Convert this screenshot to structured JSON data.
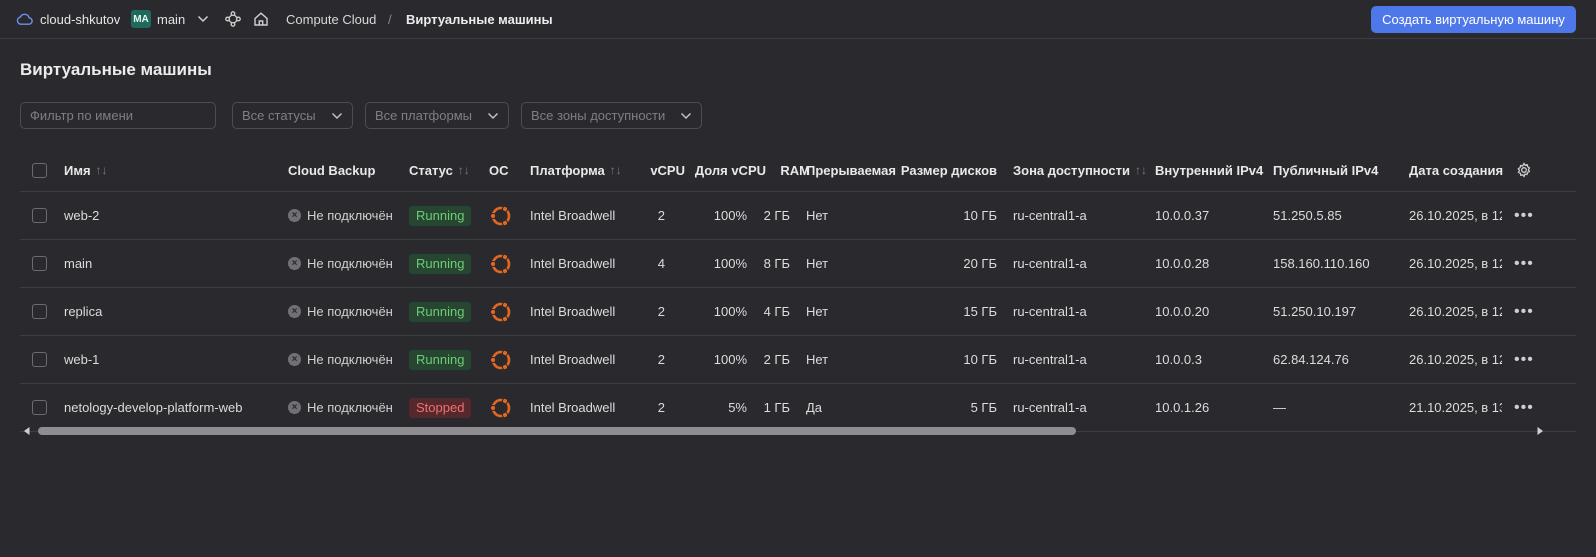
{
  "header": {
    "cloud_name": "cloud-shkutov",
    "folder_badge": "MA",
    "folder_name": "main",
    "service": "Compute Cloud",
    "separator": "/",
    "current_page": "Виртуальные машины",
    "create_button": "Создать виртуальную машину",
    "accent_color": "#4e78ea"
  },
  "page": {
    "title": "Виртуальные машины"
  },
  "filters": {
    "name_placeholder": "Фильтр по имени",
    "status": "Все статусы",
    "platform": "Все платформы",
    "zone": "Все зоны доступности"
  },
  "table": {
    "columns": {
      "name": "Имя",
      "backup": "Cloud Backup",
      "status": "Статус",
      "os": "ОС",
      "platform": "Платформа",
      "vcpu": "vCPU",
      "vcpu_share": "Доля vCPU",
      "ram": "RAM",
      "preemptible": "Прерываемая",
      "disk_size": "Размер дисков",
      "zone": "Зона доступности",
      "internal_ip": "Внутренний IPv4",
      "public_ip": "Публичный IPv4",
      "created": "Дата создания"
    },
    "sort_icon": "↑↓",
    "rows": [
      {
        "name": "web-2",
        "backup": "Не подключён",
        "status": "Running",
        "platform": "Intel Broadwell",
        "vcpu": "2",
        "vcpu_share": "100%",
        "ram": "2 ГБ",
        "preemptible": "Нет",
        "disk_size": "10 ГБ",
        "zone": "ru-central1-a",
        "internal_ip": "10.0.0.37",
        "public_ip": "51.250.5.85",
        "created": "26.10.2025, в 12"
      },
      {
        "name": "main",
        "backup": "Не подключён",
        "status": "Running",
        "platform": "Intel Broadwell",
        "vcpu": "4",
        "vcpu_share": "100%",
        "ram": "8 ГБ",
        "preemptible": "Нет",
        "disk_size": "20 ГБ",
        "zone": "ru-central1-a",
        "internal_ip": "10.0.0.28",
        "public_ip": "158.160.110.160",
        "created": "26.10.2025, в 12"
      },
      {
        "name": "replica",
        "backup": "Не подключён",
        "status": "Running",
        "platform": "Intel Broadwell",
        "vcpu": "2",
        "vcpu_share": "100%",
        "ram": "4 ГБ",
        "preemptible": "Нет",
        "disk_size": "15 ГБ",
        "zone": "ru-central1-a",
        "internal_ip": "10.0.0.20",
        "public_ip": "51.250.10.197",
        "created": "26.10.2025, в 12"
      },
      {
        "name": "web-1",
        "backup": "Не подключён",
        "status": "Running",
        "platform": "Intel Broadwell",
        "vcpu": "2",
        "vcpu_share": "100%",
        "ram": "2 ГБ",
        "preemptible": "Нет",
        "disk_size": "10 ГБ",
        "zone": "ru-central1-a",
        "internal_ip": "10.0.0.3",
        "public_ip": "62.84.124.76",
        "created": "26.10.2025, в 12"
      },
      {
        "name": "netology-develop-platform-web",
        "backup": "Не подключён",
        "status": "Stopped",
        "platform": "Intel Broadwell",
        "vcpu": "2",
        "vcpu_share": "5%",
        "ram": "1 ГБ",
        "preemptible": "Да",
        "disk_size": "5 ГБ",
        "zone": "ru-central1-a",
        "internal_ip": "10.0.1.26",
        "public_ip": "—",
        "created": "21.10.2025, в 13"
      }
    ],
    "actions_icon": "•••",
    "status_colors": {
      "running": "#6ecb7b",
      "stopped": "#f07075"
    },
    "os_icon": "ubuntu-icon"
  }
}
